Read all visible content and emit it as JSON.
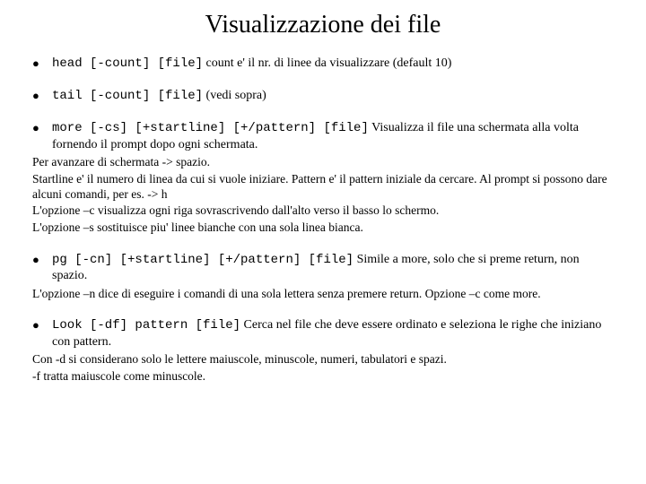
{
  "title": "Visualizzazione dei file",
  "items": [
    {
      "cmd": "head [-count] [file]",
      "desc": " count e' il nr. di linee da visualizzare (default 10)",
      "notes": []
    },
    {
      "cmd": "tail [-count] [file]",
      "desc": " (vedi sopra)",
      "notes": []
    },
    {
      "cmd": "more [-cs] [+startline] [+/pattern] [file]",
      "desc": "  Visualizza il file una schermata alla volta fornendo il prompt dopo ogni schermata.",
      "notes": [
        "Per avanzare di schermata -> spazio.",
        "Startline e' il numero di linea da cui si vuole iniziare. Pattern e' il pattern iniziale da cercare. Al prompt si possono dare alcuni comandi, per es. -> h",
        "L'opzione –c visualizza ogni riga sovrascrivendo dall'alto verso il basso lo schermo.",
        "L'opzione –s sostituisce piu' linee bianche con una sola linea bianca."
      ]
    },
    {
      "cmd": "pg [-cn] [+startline] [+/pattern] [file]",
      "desc": " Simile a more, solo che si preme return, non spazio.",
      "notes": [
        "L'opzione –n dice di eseguire i comandi di una sola lettera senza premere return. Opzione –c come more."
      ]
    },
    {
      "cmd": "Look [-df] pattern [file]",
      "desc": " Cerca nel file che deve essere ordinato e seleziona le righe che iniziano con pattern.",
      "notes": [
        "Con -d si considerano solo le lettere maiuscole, minuscole, numeri, tabulatori e spazi.",
        "-f tratta maiuscole come minuscole."
      ]
    }
  ]
}
